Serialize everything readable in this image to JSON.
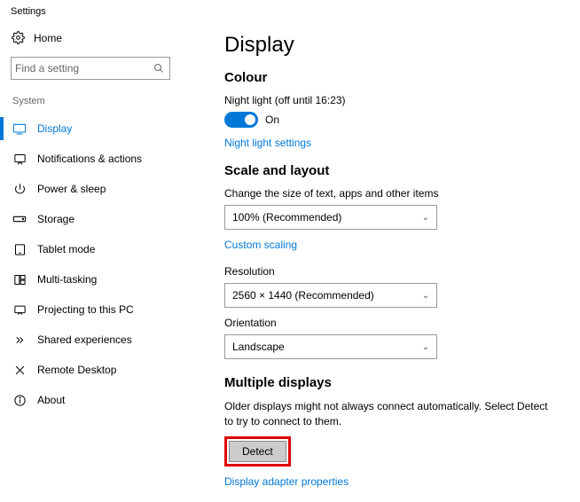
{
  "header": {
    "title": "Settings"
  },
  "sidebar": {
    "home": "Home",
    "search_placeholder": "Find a setting",
    "section": "System",
    "items": [
      {
        "label": "Display"
      },
      {
        "label": "Notifications & actions"
      },
      {
        "label": "Power & sleep"
      },
      {
        "label": "Storage"
      },
      {
        "label": "Tablet mode"
      },
      {
        "label": "Multi-tasking"
      },
      {
        "label": "Projecting to this PC"
      },
      {
        "label": "Shared experiences"
      },
      {
        "label": "Remote Desktop"
      },
      {
        "label": "About"
      }
    ]
  },
  "main": {
    "title": "Display",
    "colour": {
      "heading": "Colour",
      "night_light_label": "Night light (off until 16:23)",
      "toggle_state": "On",
      "settings_link": "Night light settings"
    },
    "scale": {
      "heading": "Scale and layout",
      "text_size_label": "Change the size of text, apps and other items",
      "text_size_value": "100% (Recommended)",
      "custom_scaling": "Custom scaling",
      "resolution_label": "Resolution",
      "resolution_value": "2560 × 1440 (Recommended)",
      "orientation_label": "Orientation",
      "orientation_value": "Landscape"
    },
    "multiple": {
      "heading": "Multiple displays",
      "description": "Older displays might not always connect automatically. Select Detect to try to connect to them.",
      "detect": "Detect",
      "adapter_link": "Display adapter properties"
    }
  }
}
